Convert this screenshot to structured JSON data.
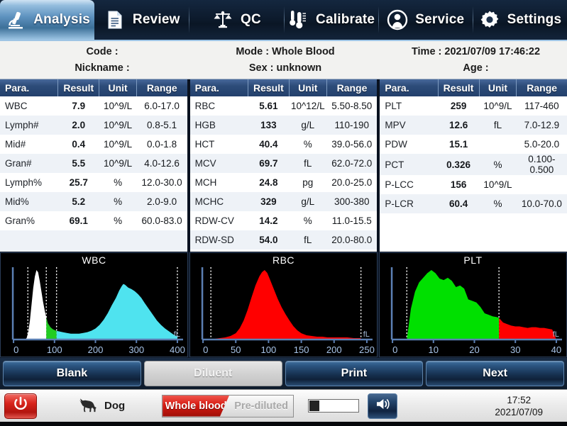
{
  "nav": {
    "tabs": [
      {
        "label": "Analysis",
        "icon": "microscope-icon",
        "active": true
      },
      {
        "label": "Review",
        "icon": "document-icon",
        "active": false
      },
      {
        "label": "QC",
        "icon": "balance-scale-icon",
        "active": false
      },
      {
        "label": "Calibrate",
        "icon": "thermometer-icon",
        "active": false
      },
      {
        "label": "Service",
        "icon": "user-icon",
        "active": false
      },
      {
        "label": "Settings",
        "icon": "gear-icon",
        "active": false
      }
    ]
  },
  "info": {
    "code_label": "Code :",
    "nickname_label": "Nickname :",
    "mode": "Mode : Whole Blood",
    "sex": "Sex : unknown",
    "time": "Time : 2021/07/09 17:46:22",
    "age": "Age :"
  },
  "tables": {
    "headers": [
      "Para.",
      "Result",
      "Unit",
      "Range"
    ],
    "groups": [
      {
        "name": "wbc-group",
        "rows": [
          {
            "para": "WBC",
            "result": "7.9",
            "unit": "10^9/L",
            "range": "6.0-17.0"
          },
          {
            "para": "Lymph#",
            "result": "2.0",
            "unit": "10^9/L",
            "range": "0.8-5.1"
          },
          {
            "para": "Mid#",
            "result": "0.4",
            "unit": "10^9/L",
            "range": "0.0-1.8"
          },
          {
            "para": "Gran#",
            "result": "5.5",
            "unit": "10^9/L",
            "range": "4.0-12.6"
          },
          {
            "para": "Lymph%",
            "result": "25.7",
            "unit": "%",
            "range": "12.0-30.0"
          },
          {
            "para": "Mid%",
            "result": "5.2",
            "unit": "%",
            "range": "2.0-9.0"
          },
          {
            "para": "Gran%",
            "result": "69.1",
            "unit": "%",
            "range": "60.0-83.0"
          }
        ]
      },
      {
        "name": "rbc-group",
        "rows": [
          {
            "para": "RBC",
            "result": "5.61",
            "unit": "10^12/L",
            "range": "5.50-8.50"
          },
          {
            "para": "HGB",
            "result": "133",
            "unit": "g/L",
            "range": "110-190"
          },
          {
            "para": "HCT",
            "result": "40.4",
            "unit": "%",
            "range": "39.0-56.0"
          },
          {
            "para": "MCV",
            "result": "69.7",
            "unit": "fL",
            "range": "62.0-72.0"
          },
          {
            "para": "MCH",
            "result": "24.8",
            "unit": "pg",
            "range": "20.0-25.0"
          },
          {
            "para": "MCHC",
            "result": "329",
            "unit": "g/L",
            "range": "300-380"
          },
          {
            "para": "RDW-CV",
            "result": "14.2",
            "unit": "%",
            "range": "11.0-15.5"
          },
          {
            "para": "RDW-SD",
            "result": "54.0",
            "unit": "fL",
            "range": "20.0-80.0"
          }
        ]
      },
      {
        "name": "plt-group",
        "rows": [
          {
            "para": "PLT",
            "result": "259",
            "unit": "10^9/L",
            "range": "117-460"
          },
          {
            "para": "MPV",
            "result": "12.6",
            "unit": "fL",
            "range": "7.0-12.9"
          },
          {
            "para": "PDW",
            "result": "15.1",
            "unit": "",
            "range": "5.0-20.0"
          },
          {
            "para": "PCT",
            "result": "0.326",
            "unit": "%",
            "range": "0.100-0.500"
          },
          {
            "para": "P-LCC",
            "result": "156",
            "unit": "10^9/L",
            "range": ""
          },
          {
            "para": "P-LCR",
            "result": "60.4",
            "unit": "%",
            "range": "10.0-70.0"
          }
        ]
      }
    ]
  },
  "chart_data": [
    {
      "type": "area",
      "name": "wbc-histogram",
      "title": "WBC",
      "xlabel": "fL",
      "ylabel": "",
      "xlim": [
        0,
        400
      ],
      "ticks": [
        0,
        100,
        200,
        300,
        400
      ],
      "grid": false,
      "discriminators": [
        35,
        80,
        105,
        400
      ],
      "regions": [
        {
          "name": "lymph",
          "color": "#ffffff",
          "from": 30,
          "to": 80
        },
        {
          "name": "mid",
          "color": "#22cc22",
          "from": 80,
          "to": 105
        },
        {
          "name": "gran",
          "color": "#4fe3ef",
          "from": 105,
          "to": 400
        }
      ],
      "x": [
        28,
        32,
        36,
        40,
        44,
        48,
        52,
        56,
        60,
        64,
        68,
        72,
        76,
        80,
        84,
        90,
        96,
        104,
        112,
        120,
        130,
        140,
        150,
        160,
        170,
        180,
        190,
        200,
        210,
        220,
        230,
        240,
        250,
        258,
        264,
        268,
        272,
        280,
        288,
        296,
        304,
        312,
        320,
        330,
        340,
        350,
        360,
        370,
        380,
        390,
        400
      ],
      "values": [
        0,
        2,
        10,
        26,
        48,
        70,
        86,
        95,
        92,
        80,
        66,
        52,
        40,
        30,
        22,
        17,
        14,
        12,
        11,
        10,
        9,
        8,
        8,
        8,
        9,
        10,
        12,
        15,
        20,
        27,
        36,
        47,
        57,
        67,
        73,
        76,
        75,
        71,
        69,
        66,
        62,
        57,
        50,
        42,
        34,
        26,
        20,
        15,
        11,
        7,
        4
      ]
    },
    {
      "type": "area",
      "name": "rbc-histogram",
      "title": "RBC",
      "xlabel": "fL",
      "ylabel": "",
      "xlim": [
        0,
        250
      ],
      "ticks": [
        0,
        50,
        100,
        150,
        200,
        250
      ],
      "grid": false,
      "discriminators": [
        12,
        241
      ],
      "regions": [
        {
          "name": "rbc",
          "color": "#ff0000",
          "from": 12,
          "to": 241
        }
      ],
      "x": [
        10,
        18,
        26,
        34,
        42,
        50,
        56,
        62,
        68,
        74,
        80,
        86,
        90,
        94,
        98,
        102,
        108,
        114,
        120,
        126,
        132,
        138,
        144,
        150,
        158,
        166,
        174,
        182,
        190,
        200,
        210,
        220,
        230,
        240,
        250
      ],
      "values": [
        1,
        1,
        2,
        3,
        5,
        9,
        16,
        27,
        42,
        60,
        77,
        90,
        96,
        99,
        95,
        86,
        72,
        58,
        46,
        36,
        27,
        19,
        13,
        9,
        6,
        5,
        4,
        4,
        3,
        3,
        3,
        3,
        2,
        2,
        1
      ]
    },
    {
      "type": "area",
      "name": "plt-histogram",
      "title": "PLT",
      "xlabel": "fL",
      "ylabel": "",
      "xlim": [
        0,
        40
      ],
      "ticks": [
        0,
        10,
        20,
        30,
        40
      ],
      "grid": false,
      "discriminators": [
        3.5,
        26
      ],
      "regions": [
        {
          "name": "plt",
          "color": "#00e000",
          "from": 3.5,
          "to": 26
        },
        {
          "name": "large-cells",
          "color": "#ff0000",
          "from": 26,
          "to": 40
        }
      ],
      "x": [
        3.5,
        4.5,
        5.5,
        6.5,
        7.5,
        8.5,
        9.5,
        10.5,
        11.5,
        12.5,
        13.5,
        14.5,
        15.5,
        16.5,
        17.5,
        18.5,
        19.5,
        20.5,
        21.5,
        22.5,
        23.5,
        24.5,
        25.5,
        26,
        27,
        28,
        29,
        30,
        31,
        32,
        33,
        34,
        35,
        36,
        37,
        38,
        39,
        40
      ],
      "values": [
        0,
        40,
        62,
        74,
        80,
        86,
        90,
        86,
        79,
        77,
        80,
        76,
        68,
        70,
        66,
        52,
        50,
        48,
        42,
        34,
        32,
        30,
        29,
        28,
        22,
        20,
        18,
        17,
        17,
        16,
        15,
        16,
        16,
        15,
        15,
        14,
        13,
        0
      ]
    }
  ],
  "actions": {
    "buttons": [
      {
        "label": "Blank",
        "name": "blank-button",
        "disabled": false
      },
      {
        "label": "Diluent",
        "name": "diluent-button",
        "disabled": true
      },
      {
        "label": "Print",
        "name": "print-button",
        "disabled": false
      },
      {
        "label": "Next",
        "name": "next-button",
        "disabled": false
      }
    ]
  },
  "status": {
    "power_icon": "power-icon",
    "species": "Dog",
    "species_icon": "dog-icon",
    "mode_on": "Whole blood",
    "mode_off": "Pre-diluted",
    "progress_percent": 20,
    "speaker_icon": "speaker-icon",
    "time": "17:52",
    "date": "2021/07/09"
  },
  "colors": {
    "accent_blue": "#2d4c79",
    "active_tab": "#5e92bf",
    "alarm_red": "#d61b12",
    "wbc_lymph": "#ffffff",
    "wbc_mid": "#22cc22",
    "wbc_gran": "#4fe3ef",
    "rbc": "#ff0000",
    "plt": "#00e000"
  }
}
